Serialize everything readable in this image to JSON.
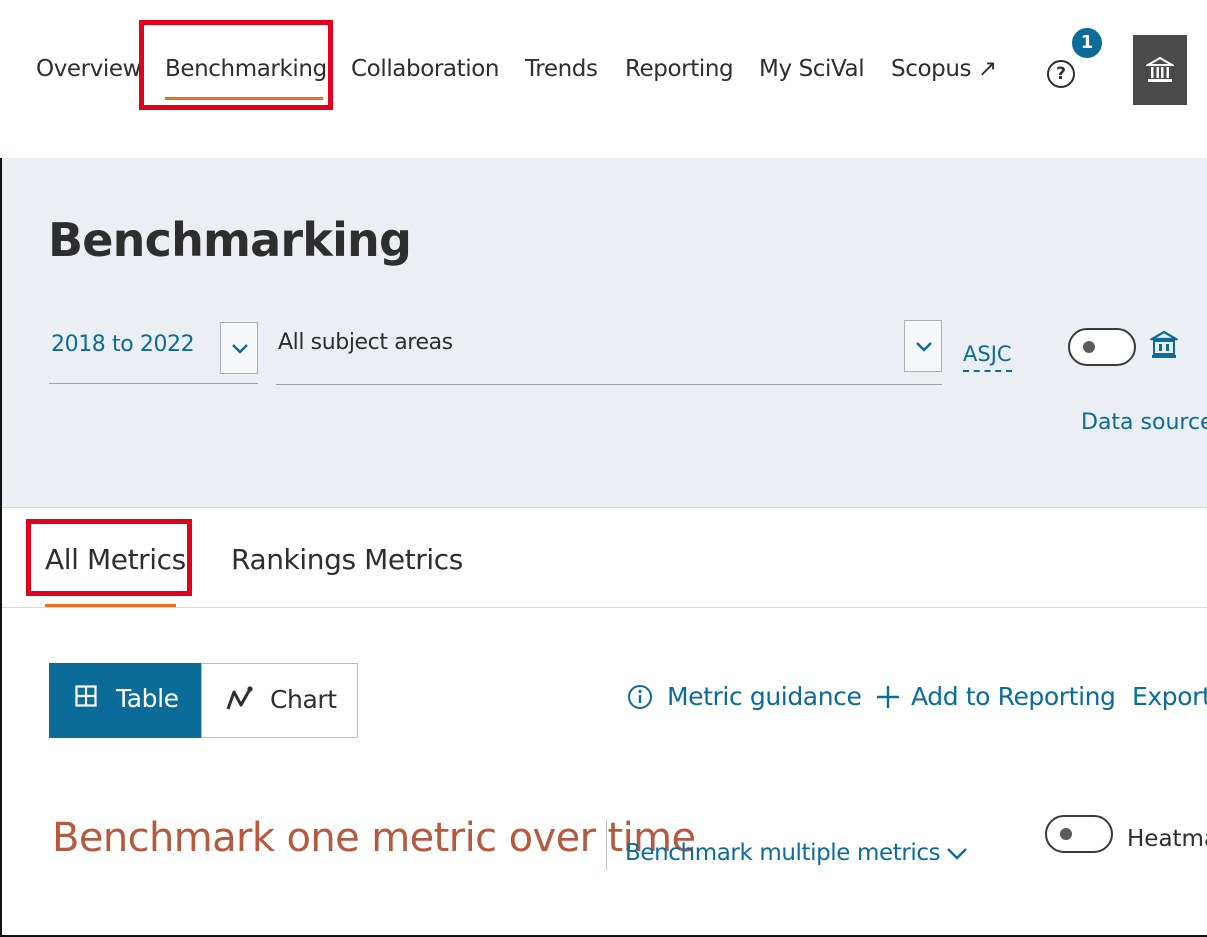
{
  "nav": {
    "items": [
      "Overview",
      "Benchmarking",
      "Collaboration",
      "Trends",
      "Reporting",
      "My SciVal",
      "Scopus ↗"
    ],
    "help_badge": "1",
    "help_glyph": "?"
  },
  "header": {
    "title": "Benchmarking",
    "year_range": "2018 to 2022",
    "subject_areas": "All subject areas",
    "classification": "ASJC",
    "data_source_label": "Data source"
  },
  "tabs": [
    "All Metrics",
    "Rankings Metrics"
  ],
  "view": {
    "table_label": "Table",
    "chart_label": "Chart",
    "active": "Table"
  },
  "actions": {
    "metric_guidance": "Metric guidance",
    "add_to_reporting": "Add to Reporting",
    "export": "Export"
  },
  "benchmark": {
    "title": "Benchmark one metric over time",
    "multiple_label": "Benchmark multiple metrics",
    "heatmap_label": "Heatmap"
  },
  "colors": {
    "accent_blue": "#0b6b99",
    "active_underline": "#e9711c",
    "highlight_red": "#e3001b",
    "title_rust": "#b5593f",
    "header_band": "#ebeff3"
  },
  "icons": [
    "help-icon",
    "institution-icon",
    "chevron-down-icon",
    "bank-icon",
    "grid-table-icon",
    "line-chart-icon",
    "info-icon",
    "plus-icon"
  ]
}
